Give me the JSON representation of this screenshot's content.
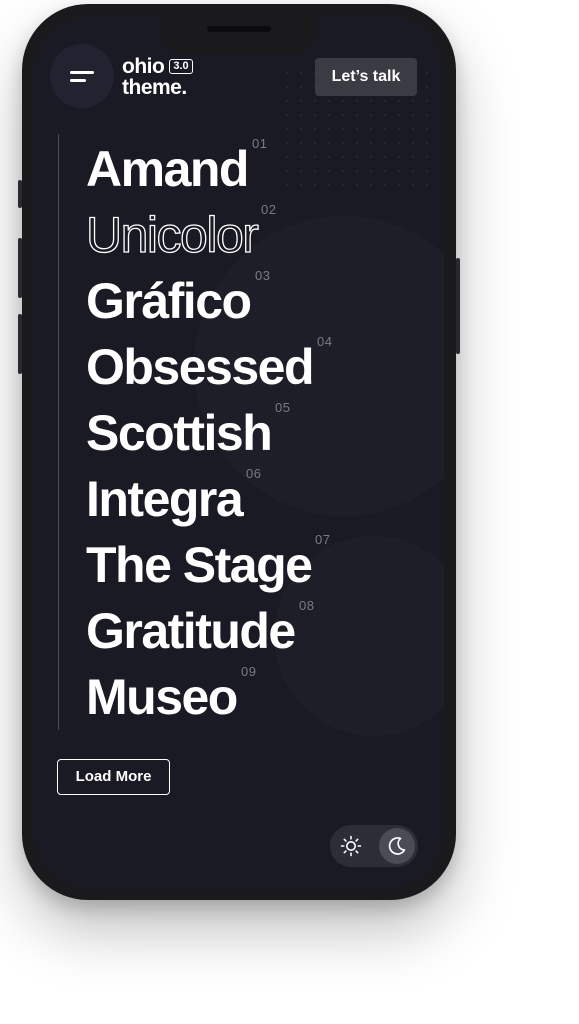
{
  "header": {
    "logo_line1": "ohio",
    "logo_line2": "theme.",
    "logo_version": "3.0",
    "cta_label": "Let’s talk"
  },
  "projects": [
    {
      "title": "Amand",
      "number": "01",
      "style": "solid"
    },
    {
      "title": "Unicolor",
      "number": "02",
      "style": "outline"
    },
    {
      "title": "Gráfico",
      "number": "03",
      "style": "solid"
    },
    {
      "title": "Obsessed",
      "number": "04",
      "style": "solid"
    },
    {
      "title": "Scottish",
      "number": "05",
      "style": "solid"
    },
    {
      "title": "Integra",
      "number": "06",
      "style": "solid"
    },
    {
      "title": "The Stage",
      "number": "07",
      "style": "solid"
    },
    {
      "title": "Gratitude",
      "number": "08",
      "style": "solid"
    },
    {
      "title": "Museo",
      "number": "09",
      "style": "solid"
    }
  ],
  "load_more_label": "Load More",
  "theme_toggle": {
    "light_icon": "sun-icon",
    "dark_icon": "moon-icon",
    "active": "dark"
  },
  "colors": {
    "screen_bg": "#191a24",
    "text": "#ffffff",
    "number": "#7a7b85",
    "button_bg": "#3a3b43"
  }
}
